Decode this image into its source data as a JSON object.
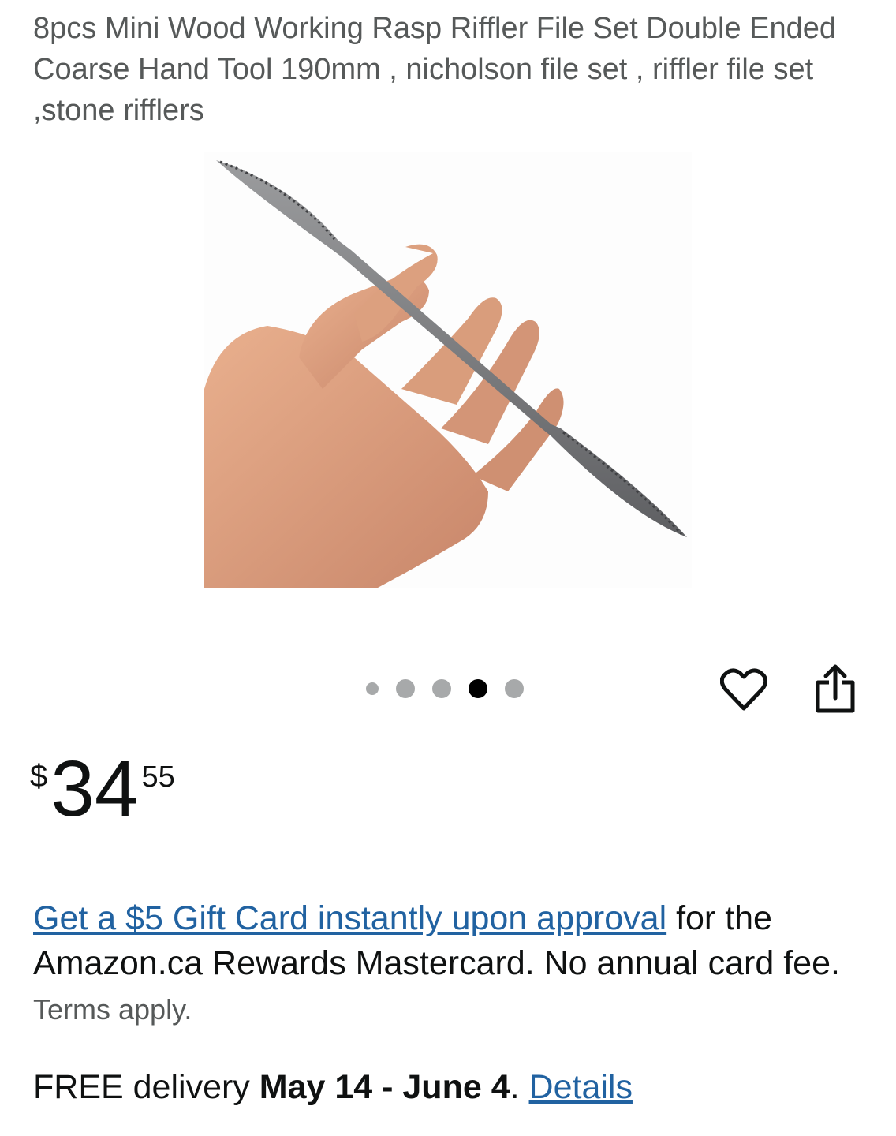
{
  "product": {
    "title": "8pcs Mini Wood Working Rasp Riffler File Set Double Ended Coarse Hand Tool 190mm , nicholson file set , riffler file set ,stone rifflers",
    "image_alt": "Hand holding a double ended riffler rasp file"
  },
  "carousel": {
    "count": 5,
    "active_index": 3
  },
  "actions": {
    "wishlist_icon": "heart-icon",
    "share_icon": "share-icon"
  },
  "price": {
    "symbol": "$",
    "whole": "34",
    "fraction": "55"
  },
  "promo": {
    "link_text": "Get a $5 Gift Card instantly upon approval",
    "text": " for the Amazon.ca Rewards Mastercard. No annual card fee. ",
    "terms": "Terms apply."
  },
  "delivery": {
    "prefix": "FREE delivery ",
    "dates": "May 14 - June 4",
    "period": ". ",
    "details_link": "Details"
  },
  "colors": {
    "link": "#2162a1",
    "muted": "#565959",
    "text": "#0f1111"
  }
}
